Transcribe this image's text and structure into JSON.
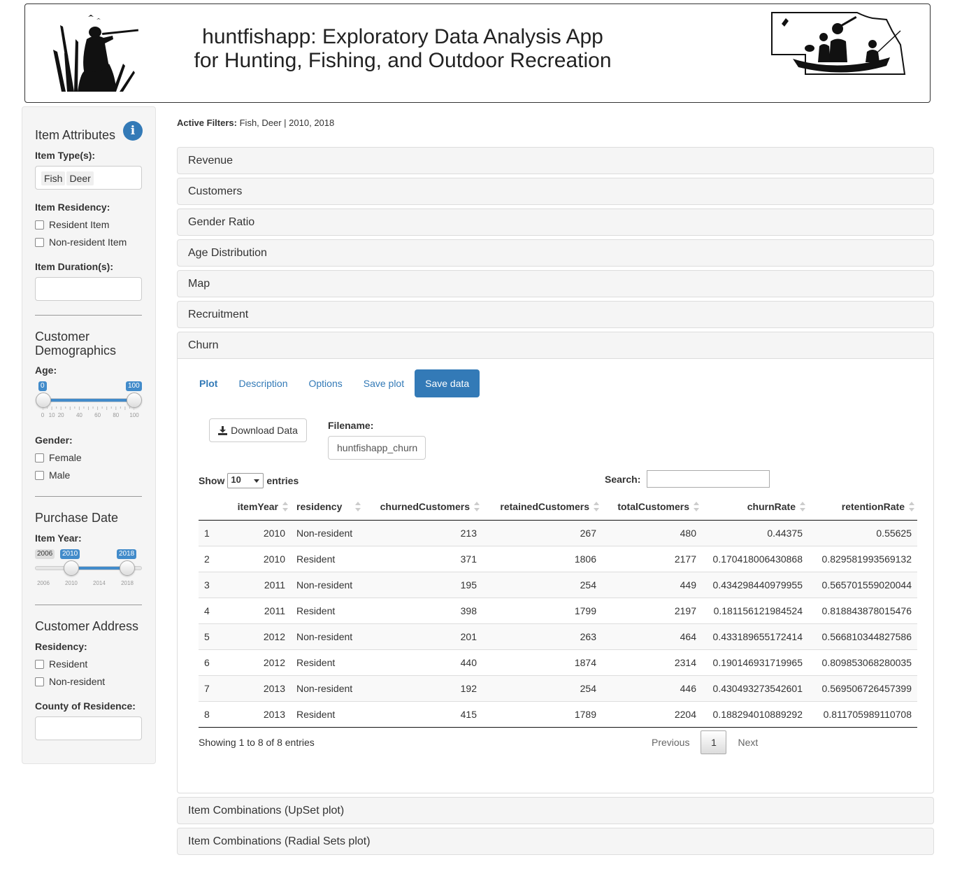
{
  "header": {
    "title_line1": "huntfishapp: Exploratory Data Analysis App",
    "title_line2": "for Hunting, Fishing, and Outdoor Recreation",
    "left_logo": "hunter-silhouette-icon",
    "right_logo": "nebraska-boat-fishing-icon"
  },
  "sidebar": {
    "item_attributes": {
      "heading": "Item Attributes",
      "info_icon": "info-icon",
      "item_types_label": "Item Type(s):",
      "item_types": [
        "Fish",
        "Deer"
      ],
      "residency_label": "Item Residency:",
      "residency_options": [
        "Resident Item",
        "Non-resident Item"
      ],
      "duration_label": "Item Duration(s):"
    },
    "demographics": {
      "heading_line1": "Customer",
      "heading_line2": "Demographics",
      "age_label": "Age:",
      "age_min": "0",
      "age_max": "100",
      "age_ticks": [
        "0",
        "10",
        "20",
        "40",
        "60",
        "80",
        "100"
      ],
      "gender_label": "Gender:",
      "gender_options": [
        "Female",
        "Male"
      ]
    },
    "purchase": {
      "heading": "Purchase Date",
      "year_label": "Item Year:",
      "year_floor": "2006",
      "year_from": "2010",
      "year_to": "2018",
      "year_ticks": [
        "2006",
        "2010",
        "2014",
        "2018"
      ]
    },
    "address": {
      "heading": "Customer Address",
      "residency_label": "Residency:",
      "residency_options": [
        "Resident",
        "Non-resident"
      ],
      "county_label": "County of Residence:"
    }
  },
  "main": {
    "filters_label": "Active Filters:",
    "filters_value": "Fish, Deer | 2010, 2018",
    "panels_top": [
      "Revenue",
      "Customers",
      "Gender Ratio",
      "Age Distribution",
      "Map",
      "Recruitment",
      "Churn"
    ],
    "panels_bottom": [
      "Item Combinations (UpSet plot)",
      "Item Combinations (Radial Sets plot)"
    ],
    "tabs": [
      "Plot",
      "Description",
      "Options",
      "Save plot",
      "Save data"
    ],
    "active_tab": "Save data",
    "download_button": "Download Data",
    "download_icon": "download-icon",
    "filename_label": "Filename:",
    "filename_value": "huntfishapp_churn",
    "show_label": "Show",
    "show_value": "10",
    "entries_label": "entries",
    "search_label": "Search:",
    "table": {
      "columns": [
        "",
        "itemYear",
        "residency",
        "churnedCustomers",
        "retainedCustomers",
        "totalCustomers",
        "churnRate",
        "retentionRate"
      ],
      "rows": [
        [
          "1",
          "2010",
          "Non-resident",
          "213",
          "267",
          "480",
          "0.44375",
          "0.55625"
        ],
        [
          "2",
          "2010",
          "Resident",
          "371",
          "1806",
          "2177",
          "0.170418006430868",
          "0.829581993569132"
        ],
        [
          "3",
          "2011",
          "Non-resident",
          "195",
          "254",
          "449",
          "0.434298440979955",
          "0.565701559020044"
        ],
        [
          "4",
          "2011",
          "Resident",
          "398",
          "1799",
          "2197",
          "0.181156121984524",
          "0.818843878015476"
        ],
        [
          "5",
          "2012",
          "Non-resident",
          "201",
          "263",
          "464",
          "0.433189655172414",
          "0.566810344827586"
        ],
        [
          "6",
          "2012",
          "Resident",
          "440",
          "1874",
          "2314",
          "0.190146931719965",
          "0.809853068280035"
        ],
        [
          "7",
          "2013",
          "Non-resident",
          "192",
          "254",
          "446",
          "0.430493273542601",
          "0.569506726457399"
        ],
        [
          "8",
          "2013",
          "Resident",
          "415",
          "1789",
          "2204",
          "0.188294010889292",
          "0.811705989110708"
        ]
      ]
    },
    "info_text": "Showing 1 to 8 of 8 entries",
    "pager": {
      "previous": "Previous",
      "current": "1",
      "next": "Next"
    }
  }
}
